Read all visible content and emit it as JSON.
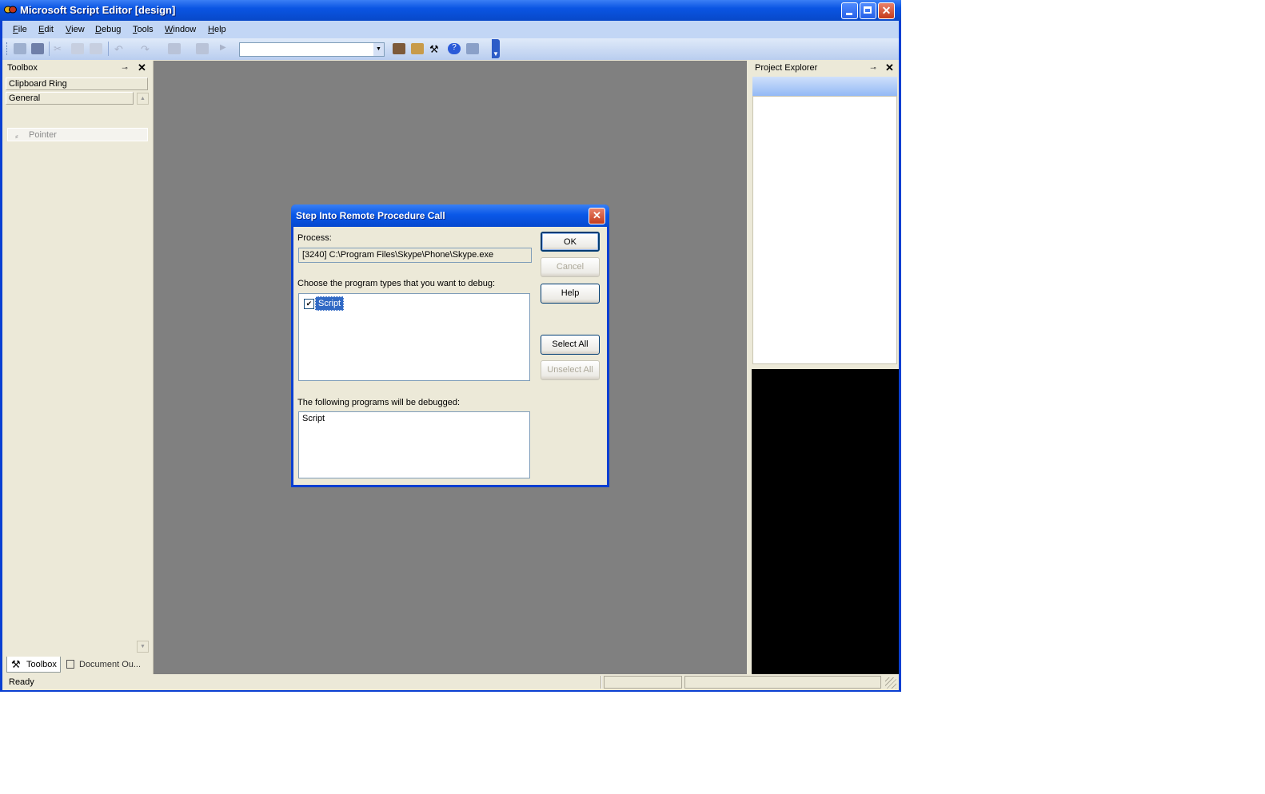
{
  "window": {
    "title": "Microsoft Script Editor [design]",
    "controls": {
      "minimize": "minimize-icon",
      "maximize": "maximize-icon",
      "close": "close-icon"
    }
  },
  "menu": {
    "items": [
      {
        "label": "File",
        "accel": "F"
      },
      {
        "label": "Edit",
        "accel": "E"
      },
      {
        "label": "View",
        "accel": "V"
      },
      {
        "label": "Debug",
        "accel": "D"
      },
      {
        "label": "Tools",
        "accel": "T"
      },
      {
        "label": "Window",
        "accel": "W"
      },
      {
        "label": "Help",
        "accel": "H"
      }
    ]
  },
  "toolbar": {
    "combo_value": ""
  },
  "toolbox": {
    "title": "Toolbox",
    "sections": [
      "Clipboard Ring",
      "General"
    ],
    "items": [
      "Pointer"
    ],
    "tabs": [
      "Toolbox",
      "Document Ou..."
    ]
  },
  "project_explorer": {
    "title": "Project Explorer"
  },
  "status": {
    "text": "Ready"
  },
  "dialog": {
    "title": "Step Into Remote Procedure Call",
    "process_label": "Process:",
    "process_value": "[3240] C:\\Program Files\\Skype\\Phone\\Skype.exe",
    "types_label": "Choose the program types that you want to debug:",
    "types": [
      {
        "label": "Script",
        "checked": true
      }
    ],
    "debugged_label": "The following programs will be debugged:",
    "debugged_list": [
      "Script"
    ],
    "buttons": {
      "ok": "OK",
      "cancel": "Cancel",
      "help": "Help",
      "select_all": "Select All",
      "unselect_all": "Unselect All"
    }
  },
  "colors": {
    "title_blue": "#0a55e3",
    "workspace_gray": "#808080",
    "face": "#ece9d8",
    "selection": "#316ac5"
  }
}
